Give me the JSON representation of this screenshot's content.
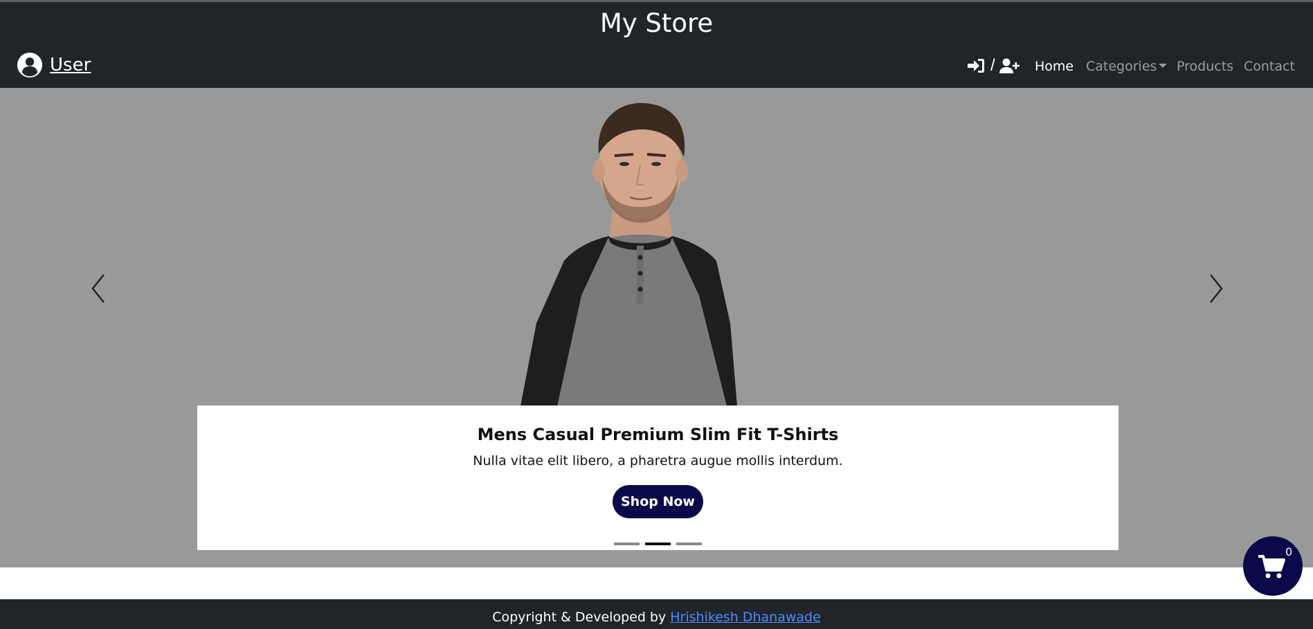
{
  "header": {
    "brand": "My Store",
    "user_label": "User",
    "auth_separator": "/",
    "nav": [
      {
        "label": "Home",
        "active": true
      },
      {
        "label": "Categories",
        "has_dropdown": true
      },
      {
        "label": "Products"
      },
      {
        "label": "Contact"
      }
    ]
  },
  "carousel": {
    "caption_title": "Mens Casual Premium Slim Fit T-Shirts",
    "caption_text": "Nulla vitae elit libero, a pharetra augue mollis interdum.",
    "button_label": "Shop Now",
    "slide_count": 3,
    "active_slide": 2
  },
  "footer": {
    "text": "Copyright & Developed by",
    "link_text": "Hrishikesh Dhanawade"
  },
  "cart": {
    "count": "0"
  },
  "colors": {
    "header_bg": "#212529",
    "carousel_bg": "#999999",
    "button_bg": "#0a0a4a",
    "link": "#4d8bff"
  },
  "icons": {
    "user": "user-circle-icon",
    "login": "sign-in-icon",
    "register": "user-plus-icon",
    "prev": "chevron-left-icon",
    "next": "chevron-right-icon",
    "cart": "shopping-cart-icon"
  }
}
